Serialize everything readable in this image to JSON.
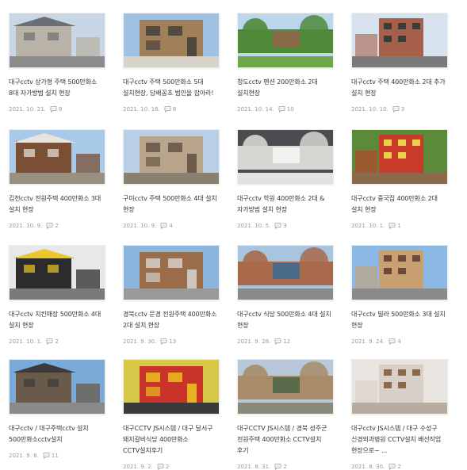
{
  "posts": [
    {
      "title": "대구cctv 상가형 주택 500만화소 8대 자가방범 설치 현장",
      "date": "2021. 10. 21.",
      "comments": "9",
      "sky": "#c8d6e6",
      "main": "#b9b2a6",
      "ground": "#8c8c8c",
      "accent": "#6b6f74"
    },
    {
      "title": "대구cctv 주택 500만화소 5대 설치현장, 담배꽁초 범인을 잡아라!",
      "date": "2021. 10. 16.",
      "comments": "8",
      "sky": "#9fc2e3",
      "main": "#a08058",
      "ground": "#d8d4cc",
      "accent": "#3a3a3a"
    },
    {
      "title": "청도cctv 펜션 200만화소 2대 설치현장",
      "date": "2021. 10. 14.",
      "comments": "10",
      "sky": "#bcd7ea",
      "main": "#4f8a3a",
      "ground": "#6fa84a",
      "accent": "#8b6a4a"
    },
    {
      "title": "대구cctv 주택 400만화소 2대 추가 설치 현장",
      "date": "2021. 10. 10.",
      "comments": "3",
      "sky": "#d6e2ee",
      "main": "#a6604a",
      "ground": "#7a7a7a",
      "accent": "#3b3b3b"
    },
    {
      "title": "김천cctv 전원주택 400만화소 3대 설치 현장",
      "date": "2021. 10. 9.",
      "comments": "2",
      "sky": "#a9c9e8",
      "main": "#7b4e36",
      "ground": "#9a8f80",
      "accent": "#e8e4de"
    },
    {
      "title": "구미cctv 주택 500만화소 4대 설치 현장",
      "date": "2021. 10. 9.",
      "comments": "4",
      "sky": "#b8cfe6",
      "main": "#b8a58c",
      "ground": "#8a8070",
      "accent": "#5a4a3c"
    },
    {
      "title": "대구cctv 학원 400만화소 2대 & 자가방범 설치 현장",
      "date": "2021. 10. 5.",
      "comments": "3",
      "sky": "#4a4c50",
      "main": "#d8d6d2",
      "ground": "#e4e2de",
      "accent": "#f2f2f0"
    },
    {
      "title": "대구cctv 중국집 400만화소 2대 설치 현장",
      "date": "2021. 10. 1.",
      "comments": "1",
      "sky": "#5a8a3a",
      "main": "#c83a2a",
      "ground": "#8a6a4a",
      "accent": "#e8d24a"
    },
    {
      "title": "대구cctv 치킨매장 500만화소 4대 설치 현장",
      "date": "2021. 10. 1.",
      "comments": "2",
      "sky": "#e8e8e8",
      "main": "#2c2c2c",
      "ground": "#7a7a7a",
      "accent": "#e8c82a"
    },
    {
      "title": "경북cctv 문경 전원주택 400만화소 2대 설치 현장",
      "date": "2021. 9. 30.",
      "comments": "13",
      "sky": "#8cb6e0",
      "main": "#9a6c4a",
      "ground": "#9a9a9a",
      "accent": "#dcdcdc"
    },
    {
      "title": "대구cctv 식당 500만화소 4대 설치 현장",
      "date": "2021. 9. 28.",
      "comments": "12",
      "sky": "#a8c4de",
      "main": "#a86a4a",
      "ground": "#8a8a8a",
      "accent": "#4a6a8a"
    },
    {
      "title": "대구cctv 빌라 500만화소 3대 설치 현장",
      "date": "2021. 9. 24.",
      "comments": "4",
      "sky": "#8cb8e4",
      "main": "#c8a072",
      "ground": "#8a8a8a",
      "accent": "#6a4a3a"
    },
    {
      "title": "대구cctv / 대구주택cctv 설치 500만화소cctv설치",
      "date": "2021. 9. 8.",
      "comments": "11",
      "sky": "#7aaad8",
      "main": "#6a5a4a",
      "ground": "#8a8a8a",
      "accent": "#3a3a3a"
    },
    {
      "title": "대구CCTV JS시스템 / 대구 달서구 돼지갈비식당 400만화소 CCTV설치후기",
      "date": "2021. 9. 2.",
      "comments": "2",
      "sky": "#d8c84a",
      "main": "#c8342a",
      "ground": "#3a3a3a",
      "accent": "#f0d020"
    },
    {
      "title": "대구CCTV JS시스템 / 경북 성주군 전원주택 400만화소 CCTV설치 후기",
      "date": "2021. 8. 31.",
      "comments": "2",
      "sky": "#b8c8d8",
      "main": "#a88c6a",
      "ground": "#8a8a7a",
      "accent": "#5a6a4a"
    },
    {
      "title": "대구cctv JS시스템 / 대구 수성구 신경외과병원 CCTV설치 배선작업 현장으로~ ...",
      "date": "2021. 8. 30.",
      "comments": "2",
      "sky": "#e8e4e0",
      "main": "#d8d0c8",
      "ground": "#b8aca0",
      "accent": "#8a6a4a"
    }
  ]
}
